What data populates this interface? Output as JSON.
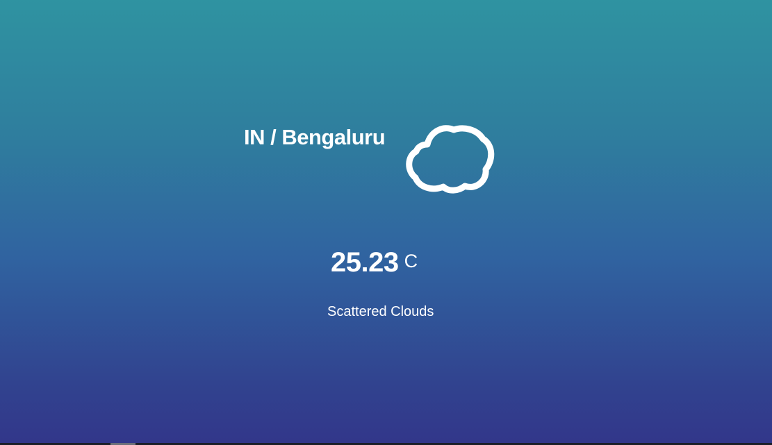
{
  "weather": {
    "location": "IN / Bengaluru",
    "icon": "cloud-icon",
    "temperature": "25.23",
    "unit": "C",
    "description": "Scattered Clouds"
  },
  "colors": {
    "gradient_top": "#2f93a1",
    "gradient_bottom": "#32368a",
    "text": "#ffffff"
  }
}
